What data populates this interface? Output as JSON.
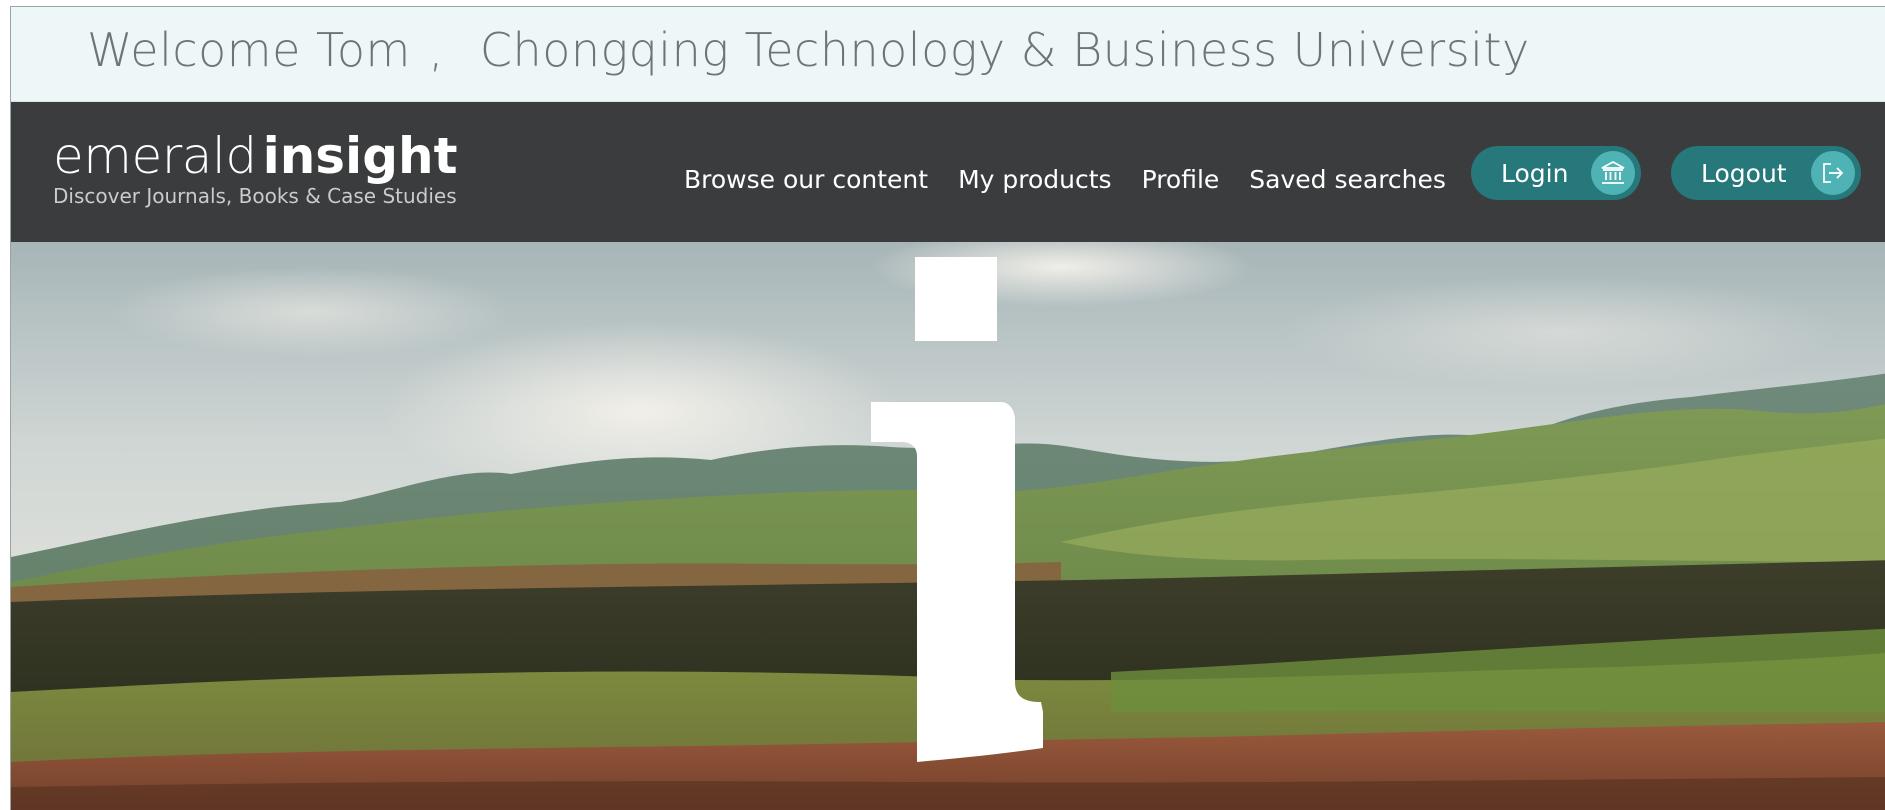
{
  "welcome": {
    "greeting": "Welcome",
    "user_name": "Tom",
    "separator": ",",
    "institution": "Chongqing Technology & Business University"
  },
  "brand": {
    "name_light": "emerald",
    "name_bold": "insight",
    "tagline": "Discover Journals, Books & Case Studies"
  },
  "nav": {
    "items": [
      {
        "label": "Browse our content"
      },
      {
        "label": "My products"
      },
      {
        "label": "Profile"
      },
      {
        "label": "Saved searches"
      }
    ]
  },
  "auth": {
    "login_label": "Login",
    "login_icon": "institution-icon",
    "logout_label": "Logout",
    "logout_icon": "logout-arrow-icon"
  },
  "hero": {
    "image": "landscape-hills-photo",
    "overlay_icon": "insight-i-logo-mark"
  },
  "colors": {
    "welcome_bg": "#eef7f8",
    "header_bg": "#3b3c3d",
    "accent": "#26787b",
    "accent_light": "#4fb3b5"
  }
}
